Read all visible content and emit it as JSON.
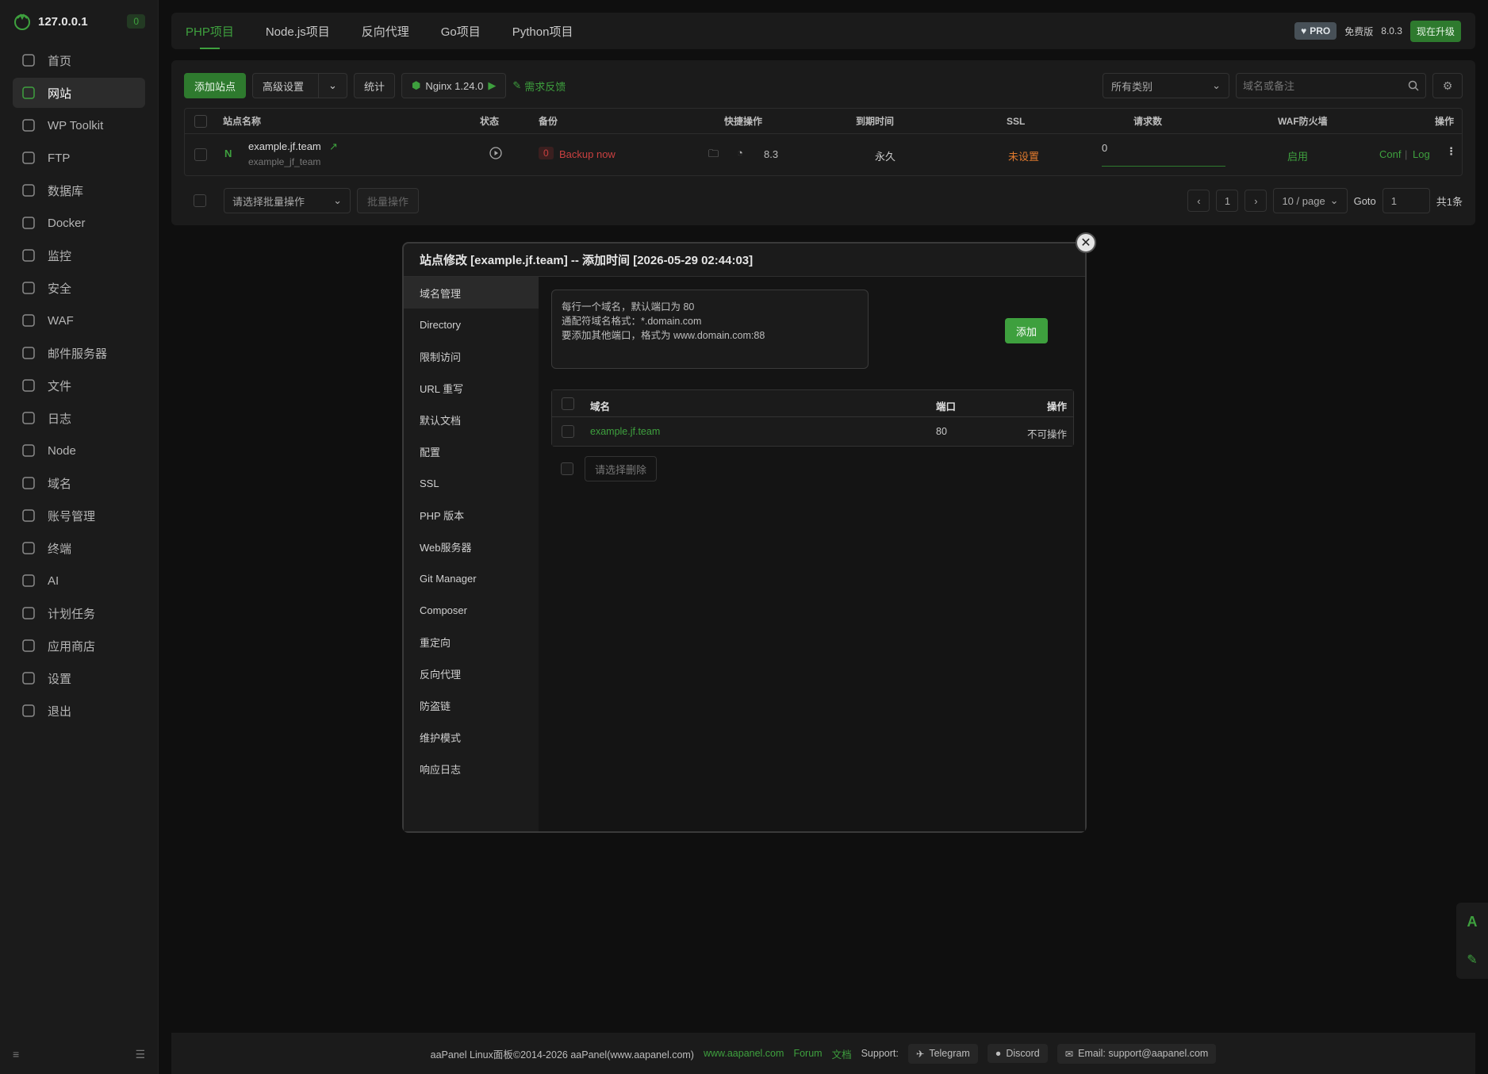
{
  "sidebar": {
    "host": "127.0.0.1",
    "badge": "0",
    "items": [
      {
        "label": "首页",
        "icon": "home-icon"
      },
      {
        "label": "网站",
        "icon": "globe-icon",
        "active": true
      },
      {
        "label": "WP Toolkit",
        "icon": "wordpress-icon"
      },
      {
        "label": "FTP",
        "icon": "transfer-icon"
      },
      {
        "label": "数据库",
        "icon": "database-icon"
      },
      {
        "label": "Docker",
        "icon": "docker-icon"
      },
      {
        "label": "监控",
        "icon": "monitor-icon"
      },
      {
        "label": "安全",
        "icon": "shield-icon"
      },
      {
        "label": "WAF",
        "icon": "waf-icon"
      },
      {
        "label": "邮件服务器",
        "icon": "mail-icon"
      },
      {
        "label": "文件",
        "icon": "folder-icon"
      },
      {
        "label": "日志",
        "icon": "log-icon"
      },
      {
        "label": "Node",
        "icon": "node-icon"
      },
      {
        "label": "域名",
        "icon": "domain-icon"
      },
      {
        "label": "账号管理",
        "icon": "user-icon"
      },
      {
        "label": "终端",
        "icon": "terminal-icon"
      },
      {
        "label": "AI",
        "icon": "ai-icon"
      },
      {
        "label": "计划任务",
        "icon": "clock-icon"
      },
      {
        "label": "应用商店",
        "icon": "store-icon"
      },
      {
        "label": "设置",
        "icon": "gear-icon"
      },
      {
        "label": "退出",
        "icon": "logout-icon"
      }
    ]
  },
  "tabs": [
    "PHP项目",
    "Node.js项目",
    "反向代理",
    "Go项目",
    "Python项目"
  ],
  "top_right": {
    "pro": "PRO",
    "edition": "免费版",
    "version": "8.0.3",
    "upgrade": "现在升级"
  },
  "toolbar": {
    "add_site": "添加站点",
    "advanced": "高级设置",
    "stats": "统计",
    "nginx": "Nginx 1.24.0",
    "feedback": "需求反馈",
    "category": "所有类别",
    "search_placeholder": "域名或备注"
  },
  "table": {
    "headers": {
      "name": "站点名称",
      "status": "状态",
      "backup": "备份",
      "quick": "快捷操作",
      "expire": "到期时间",
      "ssl": "SSL",
      "requests": "请求数",
      "waf": "WAF防火墙",
      "action": "操作"
    },
    "row": {
      "domain": "example.jf.team",
      "remark": "example_jf_team",
      "backup_count": "0",
      "backup_now": "Backup now",
      "php": "8.3",
      "expire": "永久",
      "ssl": "未设置",
      "requests": "0",
      "waf": "启用",
      "conf": "Conf",
      "log": "Log"
    }
  },
  "pager": {
    "batch_placeholder": "请选择批量操作",
    "batch_btn": "批量操作",
    "page": "1",
    "per_page": "10 / page",
    "goto": "Goto",
    "goto_val": "1",
    "total": "共1条"
  },
  "modal": {
    "title": "站点修改 [example.jf.team] -- 添加时间 [2026-05-29 02:44:03]",
    "nav": [
      "域名管理",
      "Directory",
      "限制访问",
      "URL 重写",
      "默认文档",
      "配置",
      "SSL",
      "PHP 版本",
      "Web服务器",
      "Git Manager",
      "Composer",
      "重定向",
      "反向代理",
      "防盗链",
      "维护模式",
      "响应日志"
    ],
    "textarea": "每行一个域名，默认端口为 80\n通配符域名格式：*.domain.com\n要添加其他端口，格式为 www.domain.com:88",
    "add": "添加",
    "domain_table": {
      "headers": {
        "domain": "域名",
        "port": "端口",
        "action": "操作"
      },
      "rows": [
        {
          "domain": "example.jf.team",
          "port": "80",
          "action": "不可操作"
        }
      ]
    },
    "delete_btn": "请选择删除"
  },
  "footer": {
    "copyright": "aaPanel Linux面板©2014-2026 aaPanel(www.aapanel.com)",
    "site": "www.aapanel.com",
    "forum": "Forum",
    "docs": "文档",
    "support": "Support:",
    "telegram": "Telegram",
    "discord": "Discord",
    "email": "Email: support@aapanel.com"
  },
  "colors": {
    "accent": "#3ea03e",
    "background": "#0f0f0f",
    "panel": "#1b1b1b",
    "warning": "#e07a2e",
    "danger": "#c94040"
  }
}
